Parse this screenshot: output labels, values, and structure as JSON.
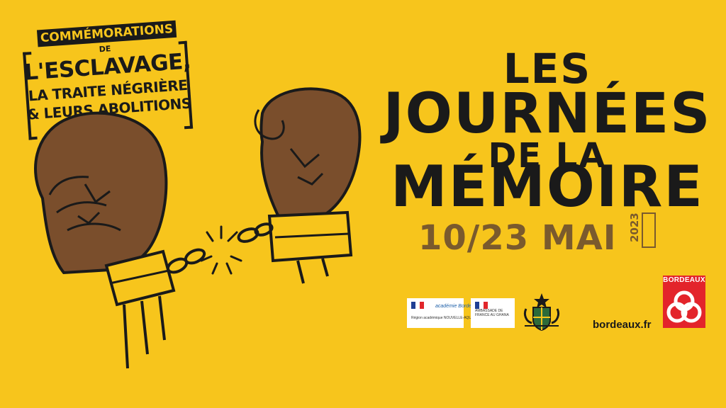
{
  "commemoration": {
    "line1": "COMMÉMORATIONS",
    "line2": "DE",
    "line3": "L'ESCLAVAGE,",
    "line4": "LA TRAITE NÉGRIÈRE",
    "line5": "& LEURS ABOLITIONS"
  },
  "title": {
    "line1": "LES",
    "line2": "JOURNÉES",
    "line3": "DE LA",
    "line4": "MÉMOIRE"
  },
  "dates": "10/23 MAI",
  "year": "2023",
  "partners": {
    "academie_name": "académie Bordeaux",
    "academie_region": "Région académique NOUVELLE-AQUITAINE",
    "ambassade": "AMBASSADE DE FRANCE AU GHANA"
  },
  "bordeaux": {
    "label": "BORDEAUX",
    "website": "bordeaux.fr"
  },
  "colors": {
    "background": "#f7c51c",
    "ink": "#1a1a1a",
    "brown": "#7a5a2d",
    "skin": "#7a4e2c",
    "bordeaux_red": "#e3242b"
  },
  "icons": [
    "broken-chain-icon",
    "raised-fist-icon",
    "ghana-coat-of-arms-icon",
    "bordeaux-logo-icon"
  ]
}
